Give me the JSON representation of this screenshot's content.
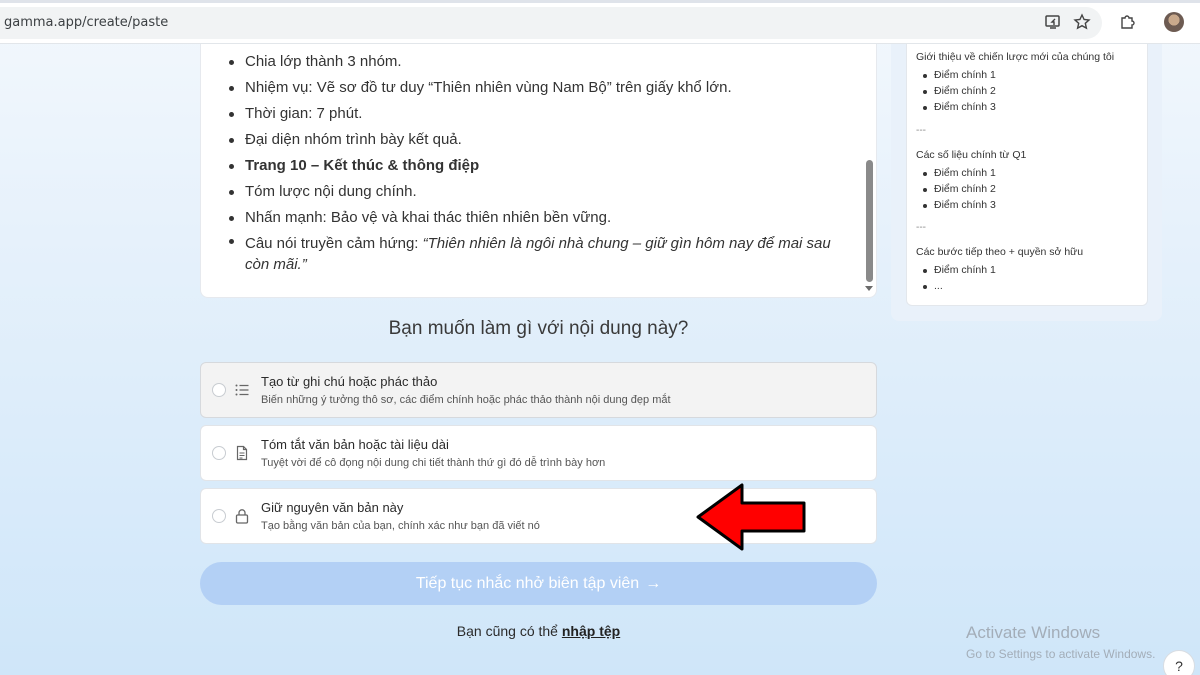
{
  "browser": {
    "url": "gamma.app/create/paste"
  },
  "content": {
    "items": [
      {
        "text": "Chia lớp thành 3 nhóm."
      },
      {
        "text": "Nhiệm vụ: Vẽ sơ đồ tư duy “Thiên nhiên vùng Nam Bộ” trên giấy khổ lớn."
      },
      {
        "text": "Thời gian: 7 phút."
      },
      {
        "text": "Đại diện nhóm trình bày kết quả."
      },
      {
        "text": "Trang 10 – Kết thúc & thông điệp"
      },
      {
        "text": "Tóm lược nội dung chính."
      },
      {
        "text": "Nhấn mạnh: Bảo vệ và khai thác thiên nhiên bền vững."
      },
      {
        "prefix": "Câu nói truyền cảm hứng: ",
        "quote": "“Thiên nhiên là ngôi nhà chung – giữ gìn hôm nay để mai sau còn mãi.”"
      }
    ]
  },
  "preview": {
    "section1": {
      "heading": "Giới thiệu về chiến lược mới của chúng tôi",
      "points": [
        "Điểm chính 1",
        "Điểm chính 2",
        "Điểm chính 3"
      ]
    },
    "sep": "---",
    "section2": {
      "heading": "Các số liệu chính từ Q1",
      "points": [
        "Điểm chính 1",
        "Điểm chính 2",
        "Điểm chính 3"
      ]
    },
    "section3": {
      "heading": "Các bước tiếp theo + quyền sở hữu",
      "points": [
        "Điểm chính 1",
        "..."
      ]
    }
  },
  "question": "Bạn muốn làm gì với nội dung này?",
  "options": [
    {
      "title": "Tạo từ ghi chú hoặc phác thảo",
      "desc": "Biến những ý tưởng thô sơ, các điểm chính hoặc phác thảo thành nội dung đẹp mắt",
      "icon": "list-icon"
    },
    {
      "title": "Tóm tắt văn bản hoặc tài liệu dài",
      "desc": "Tuyệt vời để cô đọng nội dung chi tiết thành thứ gì đó dễ trình bày hơn",
      "icon": "document-icon"
    },
    {
      "title": "Giữ nguyên văn bản này",
      "desc": "Tạo bằng văn bản của bạn, chính xác như bạn đã viết nó",
      "icon": "lock-icon"
    }
  ],
  "continue_label": "Tiếp tục nhắc nhở biên tập viên",
  "continue_arrow": "→",
  "import": {
    "prefix": "Bạn cũng có thể ",
    "link": "nhập tệp"
  },
  "watermark": {
    "title": "Activate Windows",
    "subtitle": "Go to Settings to activate Windows."
  },
  "help_label": "?",
  "colors": {
    "accent_button": "#b3d0f5",
    "annotation_arrow": "#ff0000"
  }
}
